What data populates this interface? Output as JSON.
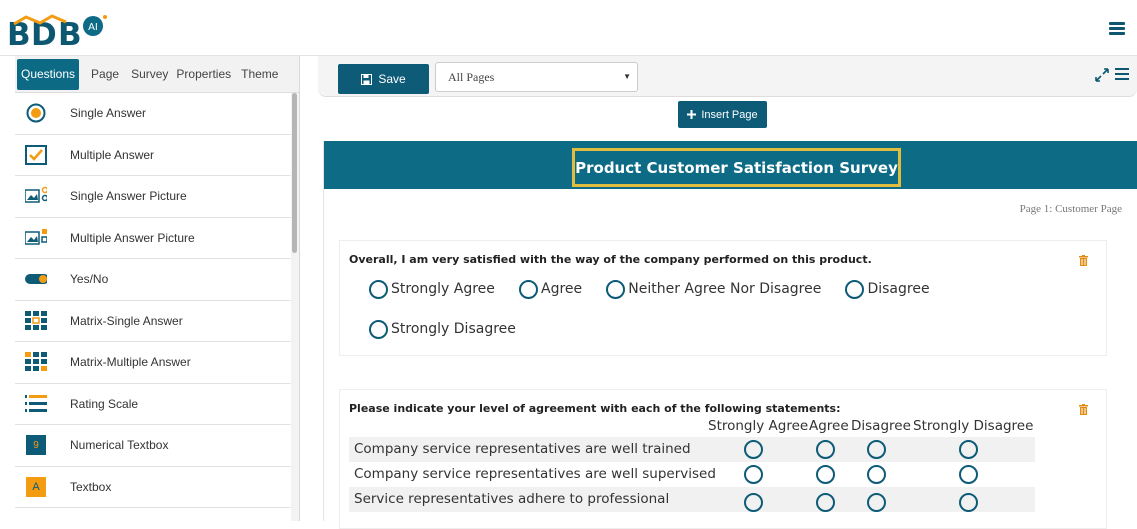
{
  "app": {
    "logo_text": "BDB",
    "logo_badge": "AI"
  },
  "left_panel": {
    "tabs": [
      {
        "label": "Questions",
        "active": true
      },
      {
        "label": "Page",
        "active": false
      },
      {
        "label": "Survey",
        "active": false
      },
      {
        "label": "Properties",
        "active": false
      },
      {
        "label": "Theme",
        "active": false
      }
    ],
    "items": [
      {
        "label": "Single Answer",
        "icon": "single-answer-icon"
      },
      {
        "label": "Multiple Answer",
        "icon": "multiple-answer-icon"
      },
      {
        "label": "Single Answer Picture",
        "icon": "single-answer-picture-icon"
      },
      {
        "label": "Multiple Answer Picture",
        "icon": "multiple-answer-picture-icon"
      },
      {
        "label": "Yes/No",
        "icon": "yes-no-toggle-icon"
      },
      {
        "label": "Matrix-Single Answer",
        "icon": "matrix-single-icon"
      },
      {
        "label": "Matrix-Multiple Answer",
        "icon": "matrix-multiple-icon"
      },
      {
        "label": "Rating Scale",
        "icon": "rating-scale-icon"
      },
      {
        "label": "Numerical Textbox",
        "icon": "numerical-textbox-icon",
        "glyph": "9"
      },
      {
        "label": "Textbox",
        "icon": "textbox-icon",
        "glyph": "A"
      }
    ]
  },
  "toolbar": {
    "save_label": "Save",
    "page_select_value": "All Pages",
    "insert_page_label": "Insert Page"
  },
  "survey": {
    "title": "Product Customer Satisfaction Survey",
    "page_label": "Page 1:  Customer Page",
    "q1": {
      "text": "Overall, I am very satisfied with the way of the company performed on this product.",
      "options": [
        "Strongly Agree",
        "Agree",
        "Neither Agree Nor Disagree",
        "Disagree",
        "Strongly Disagree"
      ]
    },
    "q2": {
      "text": "Please indicate your level of agreement with each of the following statements:",
      "columns": [
        "Strongly Agree",
        "Agree",
        "Disagree",
        "Strongly Disagree"
      ],
      "rows": [
        "Company service representatives are well trained",
        "Company service representatives are well supervised",
        "Service representatives adhere to professional"
      ]
    }
  },
  "colors": {
    "brand": "#0d6b85",
    "button": "#0d5b77",
    "accent_orange": "#f39c12",
    "title_highlight": "#e0bd3e"
  }
}
